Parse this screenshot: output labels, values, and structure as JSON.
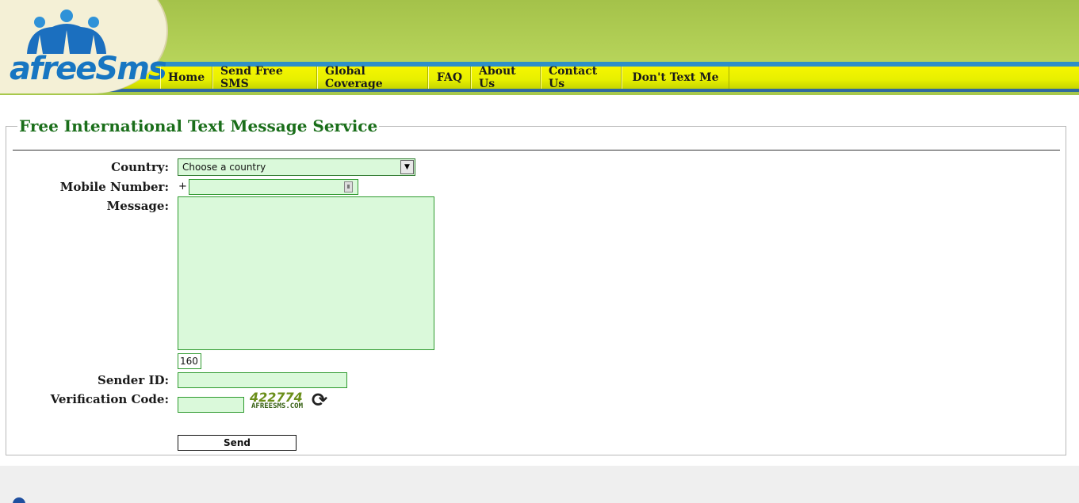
{
  "brand": {
    "logo_text": "afreeSms"
  },
  "nav": {
    "items": [
      {
        "label": "Home"
      },
      {
        "label": "Send Free SMS"
      },
      {
        "label": "Global Coverage"
      },
      {
        "label": "FAQ"
      },
      {
        "label": "About Us"
      },
      {
        "label": "Contact Us"
      },
      {
        "label": "Don't Text Me"
      }
    ]
  },
  "form": {
    "legend": "Free International Text Message Service",
    "country_label": "Country:",
    "country_value": "Choose a country",
    "mobile_label": "Mobile Number:",
    "mobile_prefix": "+",
    "mobile_value": "",
    "message_label": "Message:",
    "message_value": "",
    "char_count": "160",
    "sender_label": "Sender ID:",
    "sender_value": "",
    "verify_label": "Verification Code:",
    "verify_value": "",
    "captcha_code": "422774",
    "captcha_site": "AFREESMS.COM",
    "send_label": "Send"
  },
  "colors": {
    "header_green": "#a9c64a",
    "nav_yellow": "#f6f600",
    "stripe_blue": "#2d8fc8",
    "field_green": "#daf9da",
    "legend_green": "#1a6e1a"
  }
}
